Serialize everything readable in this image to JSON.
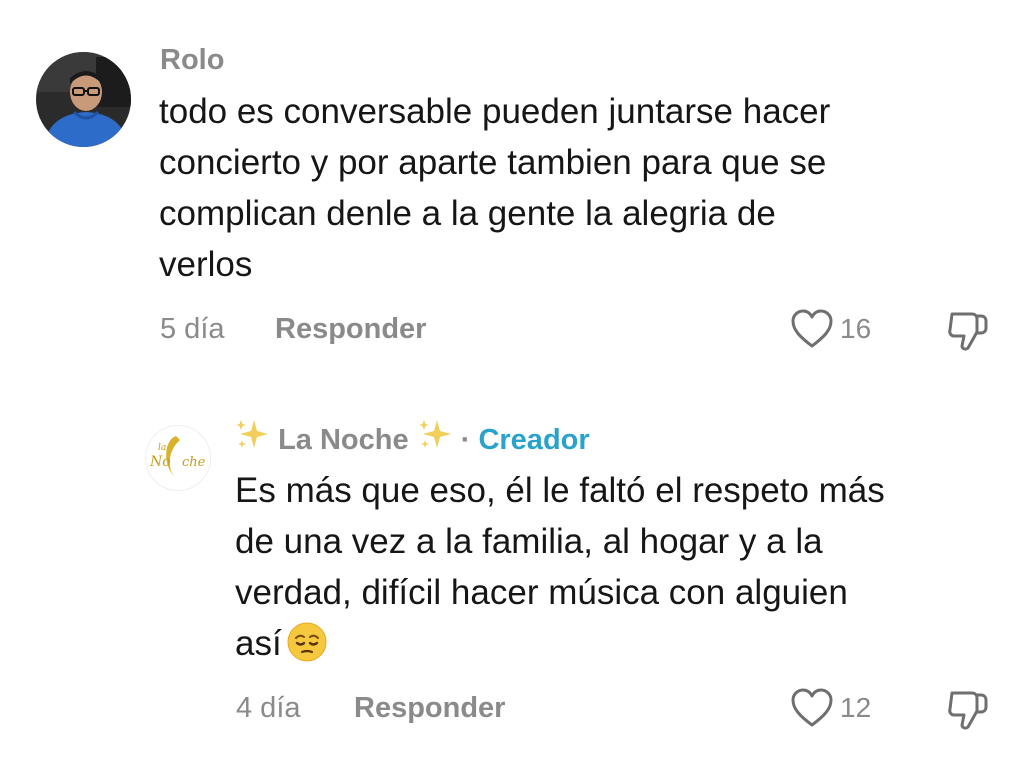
{
  "comments": [
    {
      "username": "Rolo",
      "text_lines": [
        "todo es conversable pueden juntarse hacer",
        "concierto y por aparte tambien para que se",
        "complican denle a la gente la alegria de",
        "verlos"
      ],
      "age": "5 día",
      "reply_label": "Responder",
      "likes": "16",
      "avatar_icon": "user-photo-avatar"
    },
    {
      "username": "La Noche",
      "username_decoration": "sparkles-icon",
      "separator": "·",
      "badge": "Creador",
      "text_lines": [
        "Es más que eso, él le faltó el respeto más",
        "de una vez a la familia, al hogar y a la",
        "verdad, difícil hacer música con alguien",
        "así"
      ],
      "trailing_emoji": "pensive-face-emoji",
      "age": "4 día",
      "reply_label": "Responder",
      "likes": "12",
      "avatar_icon": "la-noche-logo-avatar",
      "avatar_logo_text": "La Noche"
    }
  ],
  "colors": {
    "muted": "#8a8a8a",
    "text": "#161616",
    "creator_badge": "#2aa3cc"
  }
}
